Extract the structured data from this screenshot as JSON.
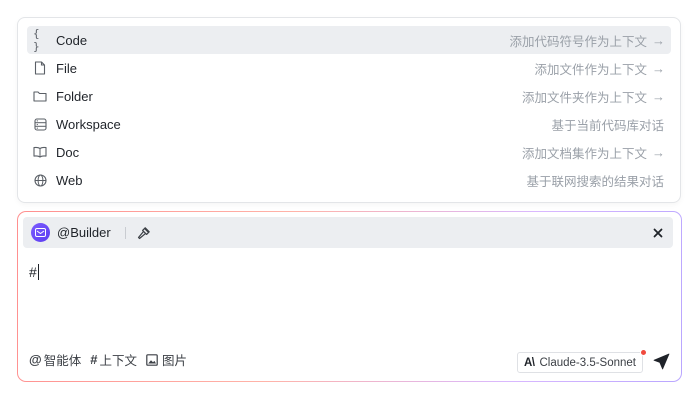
{
  "menu": {
    "items": [
      {
        "icon": "braces-icon",
        "label": "Code",
        "desc": "添加代码符号作为上下文",
        "arrow": "→"
      },
      {
        "icon": "file-icon",
        "label": "File",
        "desc": "添加文件作为上下文",
        "arrow": "→"
      },
      {
        "icon": "folder-icon",
        "label": "Folder",
        "desc": "添加文件夹作为上下文",
        "arrow": "→"
      },
      {
        "icon": "workspace-icon",
        "label": "Workspace",
        "desc": "基于当前代码库对话",
        "arrow": ""
      },
      {
        "icon": "book-icon",
        "label": "Doc",
        "desc": "添加文档集作为上下文",
        "arrow": "→"
      },
      {
        "icon": "globe-icon",
        "label": "Web",
        "desc": "基于联网搜索的结果对话",
        "arrow": ""
      }
    ],
    "braces_glyph": "{ }"
  },
  "chat": {
    "agent_name": "@Builder",
    "input_value": "#",
    "footer": {
      "agent_sym": "@",
      "agent_label": "智能体",
      "context_sym": "#",
      "context_label": "上下文",
      "image_label": "图片"
    },
    "model": {
      "logo": "A\\",
      "name": "Claude-3.5-Sonnet"
    }
  },
  "colors": {
    "accent_avatar": "#6a4bf7",
    "active_row": "#eceef1",
    "notification_dot": "#f04a3e",
    "border_gradient": [
      "#ff8f8f",
      "#ffb3a8",
      "#d9b8ff",
      "#b9a6ff"
    ]
  }
}
